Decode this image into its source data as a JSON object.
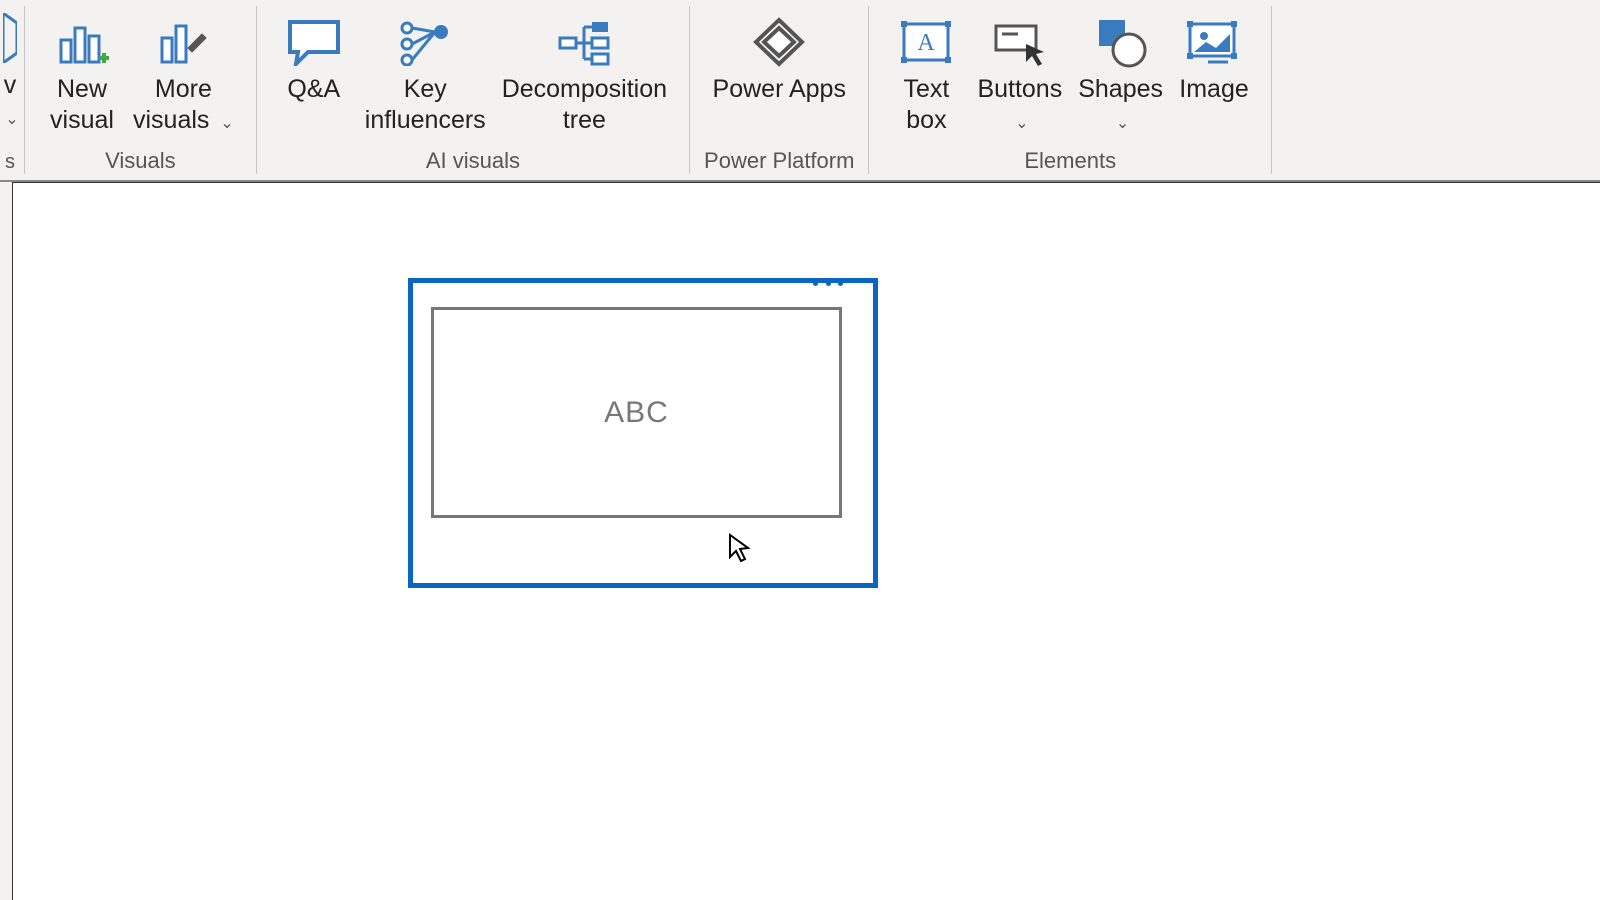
{
  "ribbon": {
    "groups": {
      "visuals": {
        "label": "Visuals",
        "new_visual": "New\nvisual",
        "more_visuals": "More\nvisuals"
      },
      "ai": {
        "label": "AI visuals",
        "qa": "Q&A",
        "key": "Key\ninfluencers",
        "decomp": "Decomposition\ntree"
      },
      "platform": {
        "label": "Power Platform",
        "apps": "Power Apps"
      },
      "elements": {
        "label": "Elements",
        "text": "Text\nbox",
        "buttons": "Buttons",
        "shapes": "Shapes",
        "image": "Image"
      }
    }
  },
  "canvas": {
    "card_text": "ABC"
  },
  "dropdown_glyph": "⌄"
}
